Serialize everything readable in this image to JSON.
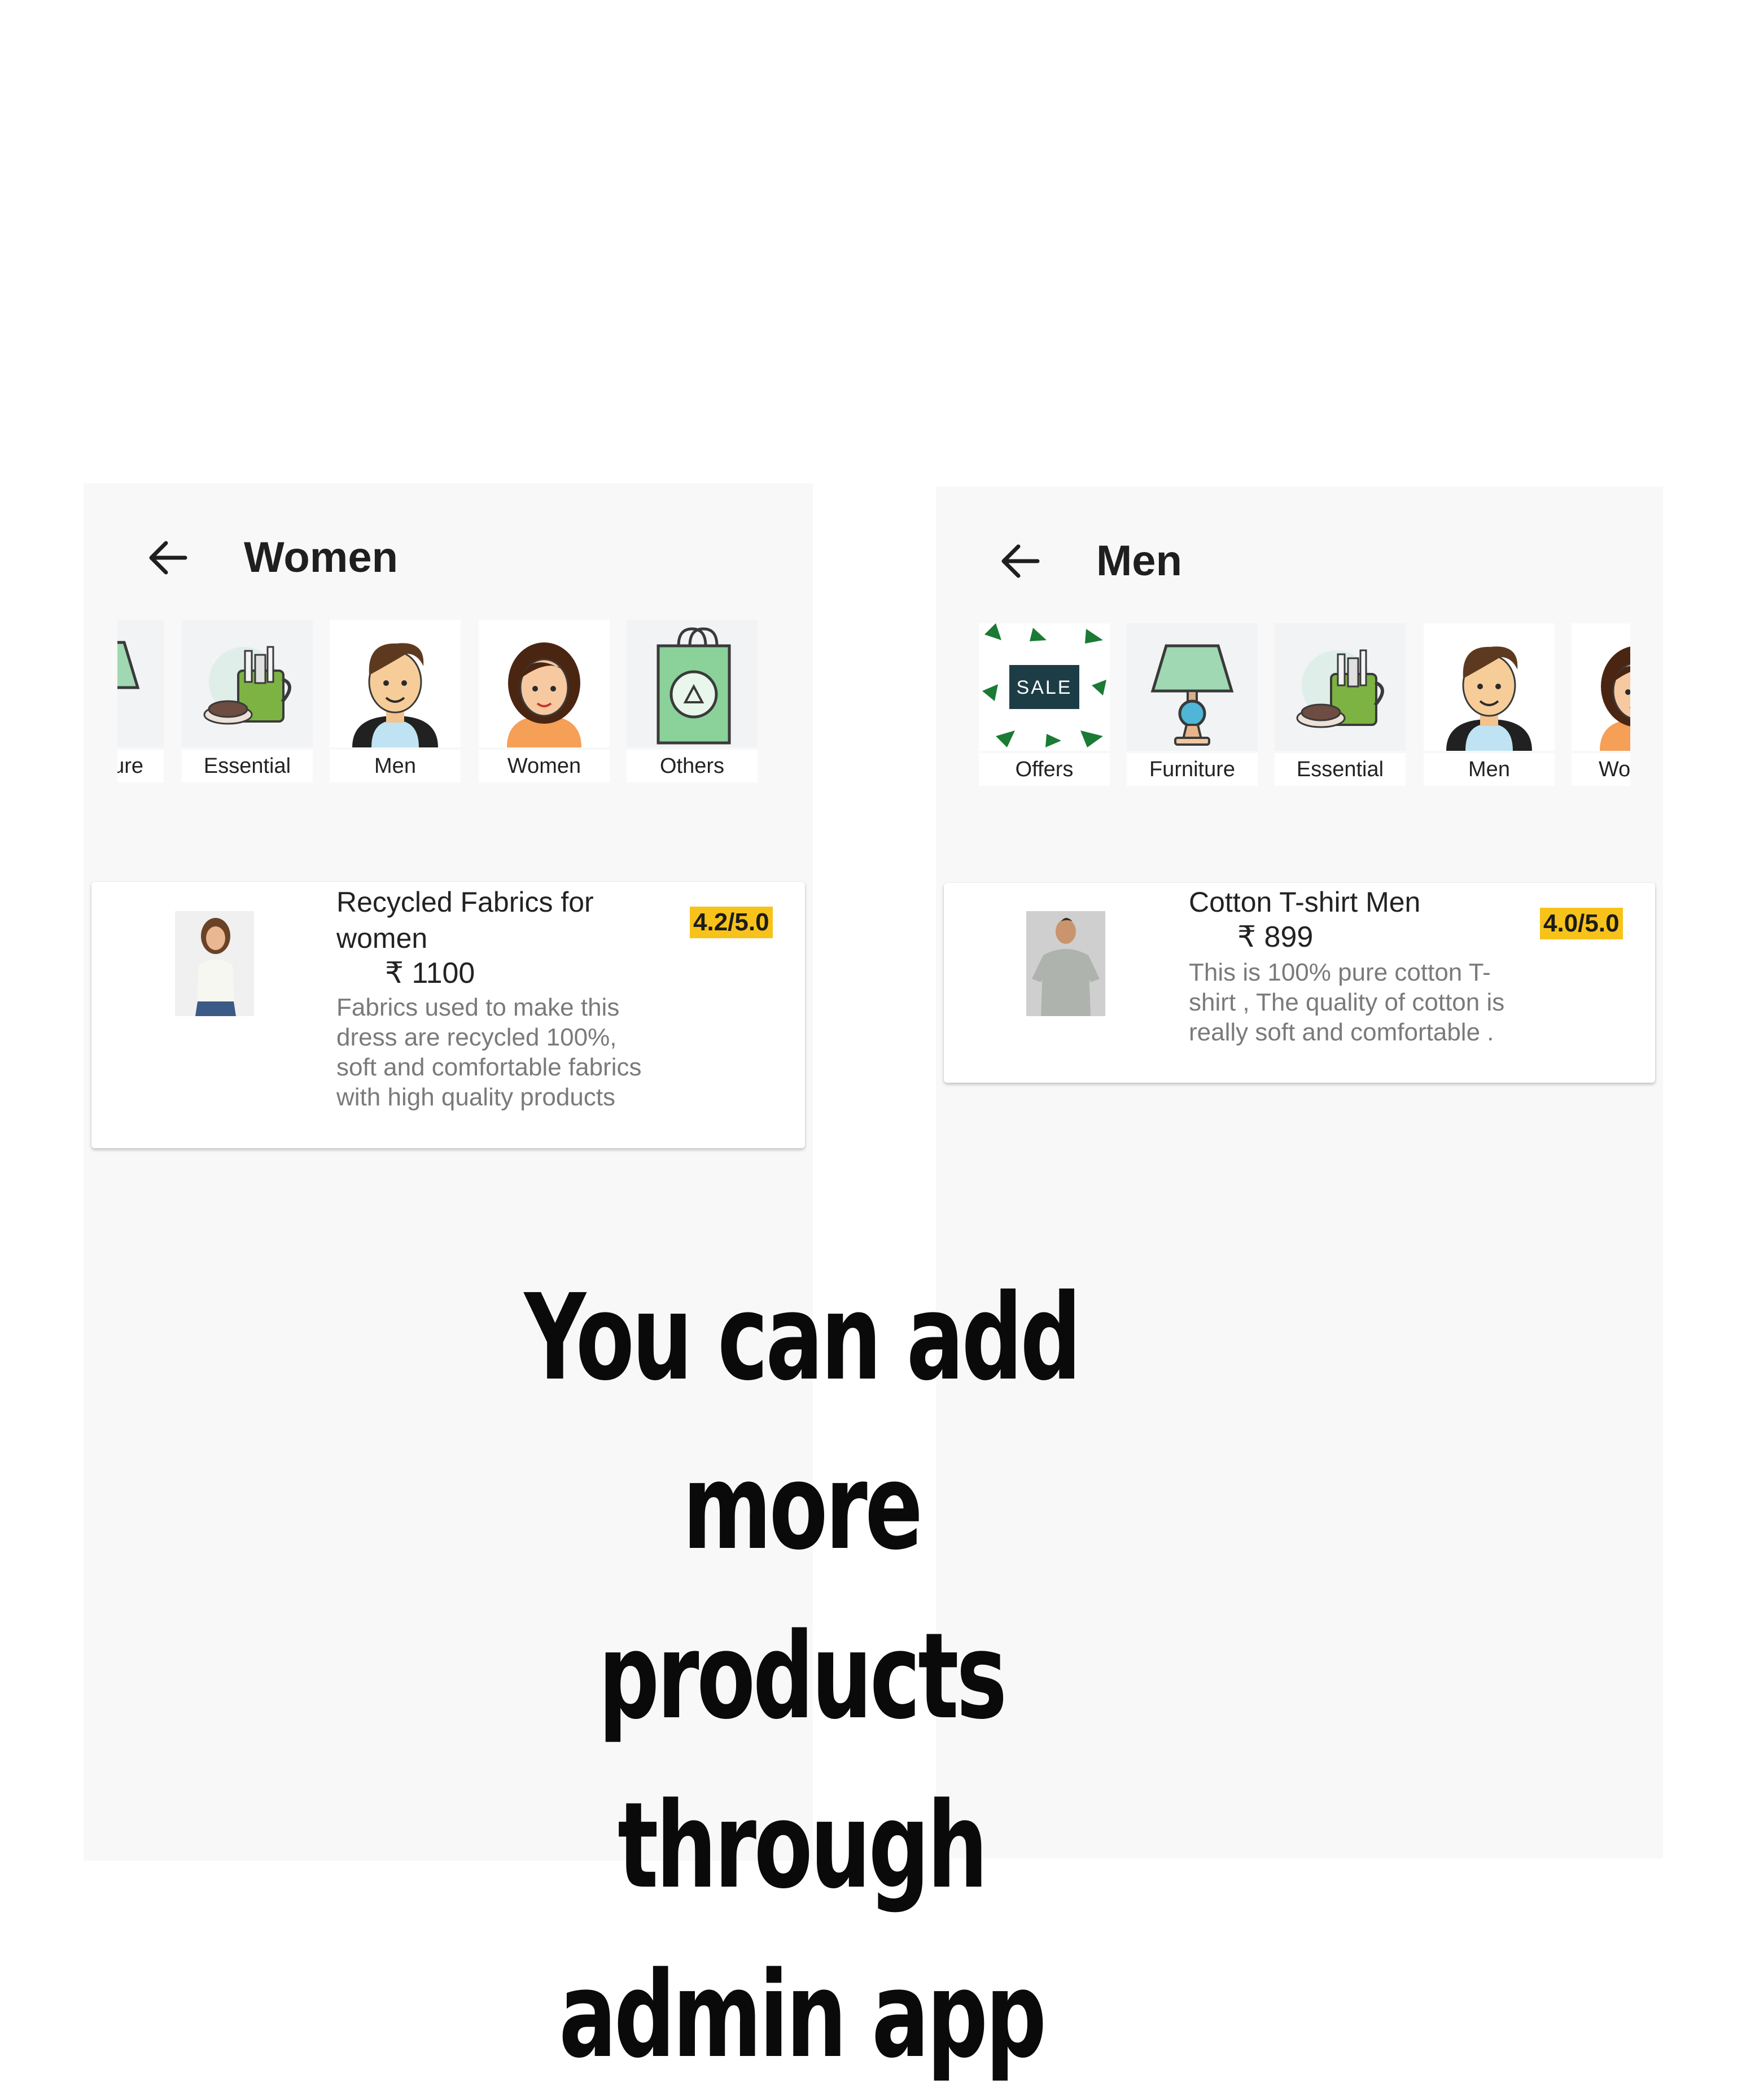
{
  "women_screen": {
    "title": "Women",
    "categories": [
      {
        "label": "ture",
        "icon": "lamp-icon"
      },
      {
        "label": "Essential",
        "icon": "toiletries-mug-icon"
      },
      {
        "label": "Men",
        "icon": "man-avatar-icon"
      },
      {
        "label": "Women",
        "icon": "woman-avatar-icon"
      },
      {
        "label": "Others",
        "icon": "recycle-bag-icon"
      }
    ],
    "product": {
      "name": "Recycled Fabrics for women",
      "price": "₹ 1100",
      "description": "Fabrics used to make this dress are recycled 100%, soft and comfortable fabrics with high quality products",
      "rating": "4.2/5.0",
      "image": "woman-model-photo"
    }
  },
  "men_screen": {
    "title": "Men",
    "categories": [
      {
        "label": "Offers",
        "icon": "sale-icon",
        "sale_text": "SALE"
      },
      {
        "label": "Furniture",
        "icon": "lamp-icon"
      },
      {
        "label": "Essential",
        "icon": "toiletries-mug-icon"
      },
      {
        "label": "Men",
        "icon": "man-avatar-icon"
      },
      {
        "label": "Wo",
        "icon": "woman-avatar-icon"
      }
    ],
    "product": {
      "name": "Cotton T-shirt Men",
      "price": "₹ 899",
      "description": "This is 100% pure cotton T-shirt , The quality of cotton is really soft and comfortable .",
      "rating": "4.0/5.0",
      "image": "man-tshirt-photo"
    }
  },
  "caption": {
    "line1": "You can add more",
    "line2": "products through",
    "line3": "admin app"
  },
  "colors": {
    "rating_badge": "#f7c21a",
    "screen_bg": "#f8f8f8",
    "accent_green": "#86c98a"
  }
}
